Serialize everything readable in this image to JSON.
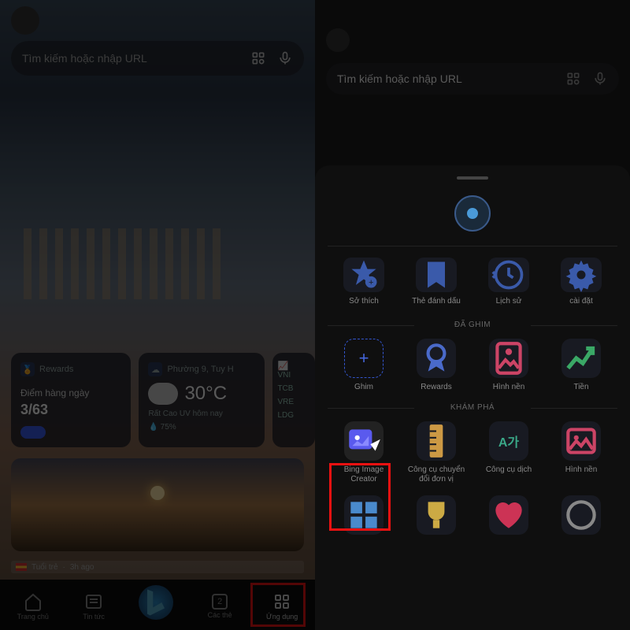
{
  "search": {
    "placeholder": "Tìm kiếm hoặc nhập URL"
  },
  "cards": {
    "rewards": {
      "title": "Rewards",
      "daily": "Điểm hàng ngày",
      "count": "3/63"
    },
    "weather": {
      "loc": "Phường 9, Tuy H",
      "temp": "30°C",
      "uv": "Rất Cao UV hôm nay",
      "humid": "💧 75%"
    },
    "stocks": [
      "VNI",
      "TCB",
      "VRE",
      "LDG"
    ]
  },
  "news": {
    "source": "Tuổi trẻ",
    "time": "3h ago"
  },
  "nav": {
    "home": "Trang chủ",
    "news": "Tin tức",
    "tabs": "Các thẻ",
    "tabs_count": "2",
    "apps": "Ứng dụng"
  },
  "quick": {
    "favorites": "Sở thích",
    "bookmarks": "Thẻ đánh dấu",
    "history": "Lịch sử",
    "settings": "cài đặt"
  },
  "sections": {
    "pinned": "ĐÃ GHIM",
    "explore": "KHÁM PHÁ"
  },
  "pinned": {
    "pin": "Ghim",
    "rewards": "Rewards",
    "wallpaper": "Hình nền",
    "money": "Tiền"
  },
  "explore": {
    "bing": "Bing Image Creator",
    "convert": "Công cụ chuyển đổi đơn vị",
    "translate": "Công cụ dịch",
    "wallpaper": "Hình nền"
  }
}
